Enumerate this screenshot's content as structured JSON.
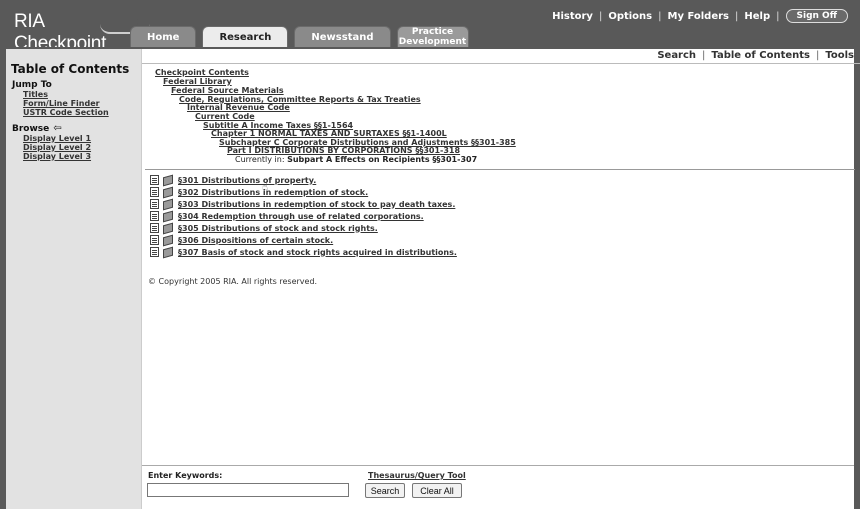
{
  "app": {
    "logo": "RIA Checkpoint"
  },
  "utility_nav": {
    "items": [
      "History",
      "Options",
      "My Folders",
      "Help"
    ],
    "sign_off": "Sign Off"
  },
  "tabs": [
    {
      "label": "Home",
      "active": false
    },
    {
      "label": "Research",
      "active": true
    },
    {
      "label": "Newsstand",
      "active": false
    },
    {
      "label_line1": "Practice",
      "label_line2": "Development",
      "active": false
    }
  ],
  "secondary_nav": [
    "Search",
    "Table of Contents",
    "Tools"
  ],
  "sidebar": {
    "title": "Table of Contents",
    "jump_to": {
      "heading": "Jump To",
      "links": [
        "Titles",
        "Form/Line Finder",
        "USTR Code Section"
      ]
    },
    "browse": {
      "heading": "Browse",
      "icon": "back-arrow-icon",
      "links": [
        "Display Level 1",
        "Display Level 2",
        "Display Level 3"
      ]
    }
  },
  "breadcrumb": [
    "Checkpoint Contents",
    "Federal Library",
    "Federal Source Materials",
    "Code, Regulations, Committee Reports & Tax Treaties",
    "Internal Revenue Code",
    "Current Code",
    "Subtitle A Income Taxes §§1-1564",
    "Chapter 1 NORMAL TAXES AND SURTAXES §§1-1400L",
    "Subchapter C Corporate Distributions and Adjustments §§301-385",
    "Part I DISTRIBUTIONS BY CORPORATIONS §§301-318"
  ],
  "current": {
    "prefix": "Currently in:",
    "value": "Subpart A Effects on Recipients §§301-307"
  },
  "sections": [
    "§301 Distributions of property.",
    "§302 Distributions in redemption of stock.",
    "§303 Distributions in redemption of stock to pay death taxes.",
    "§304 Redemption through use of related corporations.",
    "§305 Distributions of stock and stock rights.",
    "§306 Dispositions of certain stock.",
    "§307 Basis of stock and stock rights acquired in distributions."
  ],
  "copyright": "© Copyright 2005 RIA. All rights reserved.",
  "search": {
    "label": "Enter Keywords:",
    "thesaurus": "Thesaurus/Query Tool",
    "value": "",
    "search_button": "Search",
    "clear_button": "Clear All"
  }
}
